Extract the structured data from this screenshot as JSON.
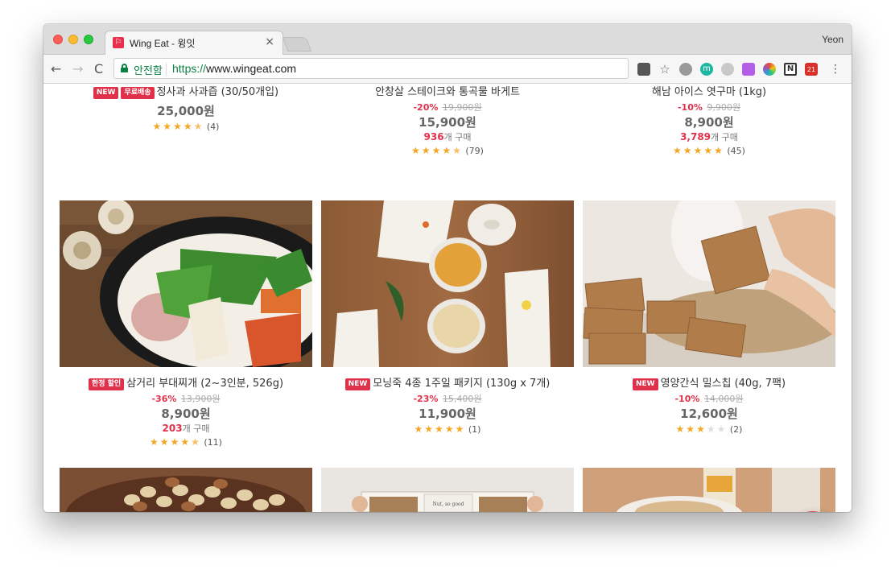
{
  "browser": {
    "tab_title": "Wing Eat - 윙잇",
    "tab_close": "×",
    "profile_name": "Yeon",
    "secure_label": "안전함",
    "url_scheme": "https://",
    "url_host": "www.wingeat.com",
    "nav_back": "←",
    "nav_forward": "→",
    "nav_reload": "C",
    "extension_badge": "21"
  },
  "products": [
    {
      "badges": [
        "NEW",
        "무료배송"
      ],
      "name": "정사과 사과즙 (30/50개입)",
      "discount": "",
      "original_price": "",
      "price": "25,000원",
      "sold_count": "",
      "sold_suffix": "",
      "rating": 4.5,
      "stars": "★★★★☆",
      "reviews": "(4)"
    },
    {
      "badges": [],
      "name": "안창살 스테이크와 통곡물 바게트",
      "discount": "-20%",
      "original_price": "19,900원",
      "price": "15,900원",
      "sold_count": "936",
      "sold_suffix": "개 구매",
      "rating": 4.5,
      "stars": "★★★★☆",
      "reviews": "(79)"
    },
    {
      "badges": [],
      "name": "해남 아이스 엿구마 (1kg)",
      "discount": "-10%",
      "original_price": "9,900원",
      "price": "8,900원",
      "sold_count": "3,789",
      "sold_suffix": "개 구매",
      "rating": 5,
      "stars": "★★★★★",
      "reviews": "(45)"
    },
    {
      "badges": [
        "한정 할인"
      ],
      "name": "삼거리 부대찌개 (2~3인분, 526g)",
      "discount": "-36%",
      "original_price": "13,900원",
      "price": "8,900원",
      "sold_count": "203",
      "sold_suffix": "개 구매",
      "rating": 4.5,
      "stars": "★★★★☆",
      "reviews": "(11)"
    },
    {
      "badges": [
        "NEW"
      ],
      "name": "모닝죽 4종 1주일 패키지 (130g x 7개)",
      "discount": "-23%",
      "original_price": "15,400원",
      "price": "11,900원",
      "sold_count": "",
      "sold_suffix": "",
      "rating": 5,
      "stars": "★★★★★",
      "reviews": "(1)"
    },
    {
      "badges": [
        "NEW"
      ],
      "name": "영양간식 밀스칩 (40g, 7팩)",
      "discount": "-10%",
      "original_price": "14,000원",
      "price": "12,600원",
      "sold_count": "",
      "sold_suffix": "",
      "rating": 3,
      "stars": "★★★☆☆",
      "reviews": "(2)"
    }
  ],
  "image_packaging_text": "Nut, so good",
  "colors": {
    "accent": "#e0314b",
    "star": "#f5a623",
    "secure": "#0b8043"
  }
}
